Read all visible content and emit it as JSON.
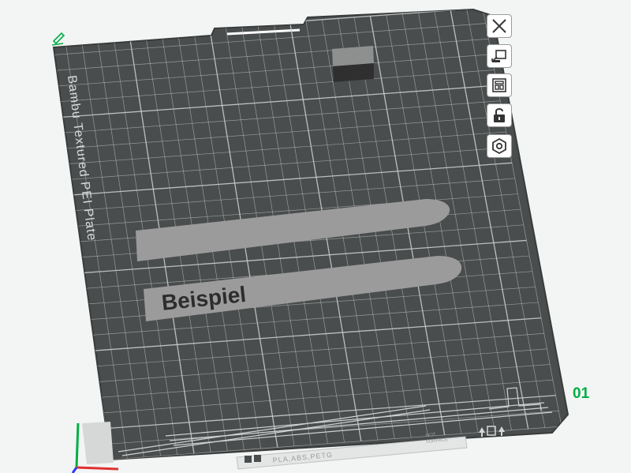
{
  "plate": {
    "name": "Bambu Textured PEI Plate",
    "number": "01",
    "label_text": "Beispiel",
    "bottom_bar_text": "PLA,ABS,PETG",
    "corner_text_1": "HOT",
    "corner_text_2": "SURFACE"
  },
  "toolbar": {
    "items": [
      {
        "icon": "close-icon",
        "name": "close"
      },
      {
        "icon": "auto-orient-icon",
        "name": "auto-orient"
      },
      {
        "icon": "arrange-icon",
        "name": "arrange"
      },
      {
        "icon": "lock-icon",
        "name": "lock"
      },
      {
        "icon": "plate-settings-icon",
        "name": "plate-settings"
      }
    ]
  },
  "colors": {
    "background": "#f3f4f4",
    "plate": "#4a4d4d",
    "grid": "#c9cccc",
    "accent_green": "#00ae42",
    "object_gray": "#9b9b9b",
    "text_dark": "#2d2d2d"
  }
}
